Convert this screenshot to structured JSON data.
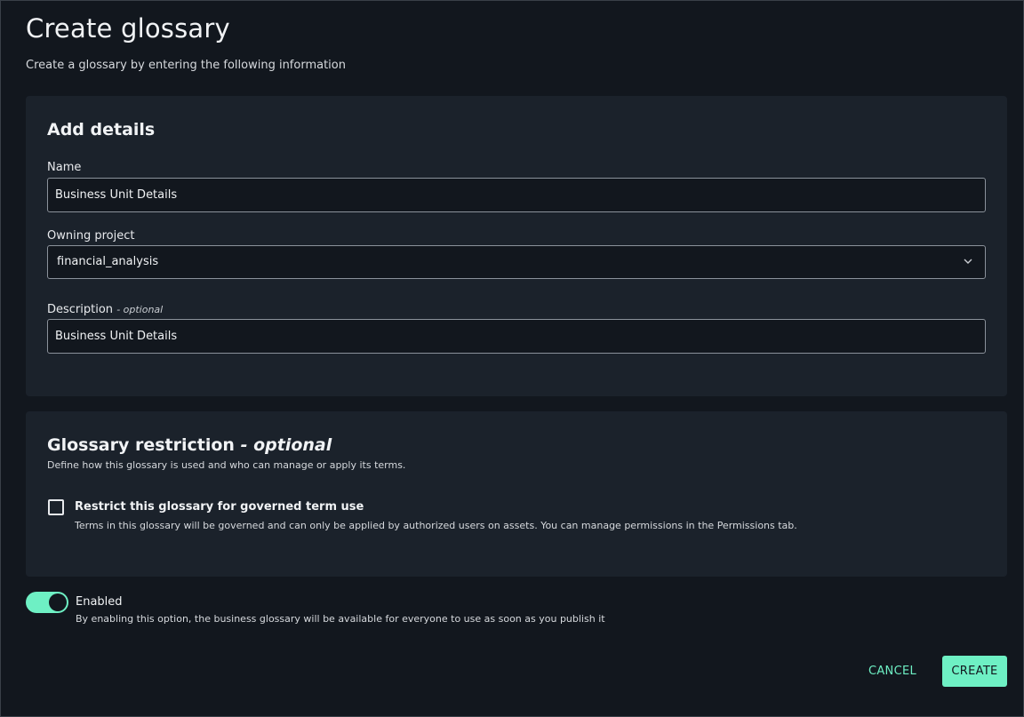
{
  "page": {
    "title": "Create glossary",
    "subtitle": "Create a glossary by entering the following information"
  },
  "details": {
    "section_title": "Add details",
    "name_label": "Name",
    "name_value": "Business Unit Details",
    "project_label": "Owning project",
    "project_value": "financial_analysis",
    "description_label": "Description",
    "description_optional": "- optional",
    "description_value": "Business Unit Details"
  },
  "restriction": {
    "title": "Glossary restriction",
    "title_optional": "- optional",
    "description": "Define how this glossary is used and who can manage or apply its terms.",
    "checkbox_label": "Restrict this glossary for governed term use",
    "checkbox_checked": false,
    "checkbox_help": "Terms in this glossary will be governed and can only be applied by authorized users on assets. You can manage permissions in the Permissions tab."
  },
  "enable": {
    "label": "Enabled",
    "on": true,
    "help": "By enabling this option, the business glossary will be available for everyone to use as soon as you publish it"
  },
  "actions": {
    "cancel_label": "CANCEL",
    "create_label": "CREATE"
  },
  "colors": {
    "accent": "#6ef0c4",
    "background": "#12171e",
    "panel": "#1b222b"
  },
  "icons": {
    "project_dropdown": "chevron-down-icon"
  }
}
